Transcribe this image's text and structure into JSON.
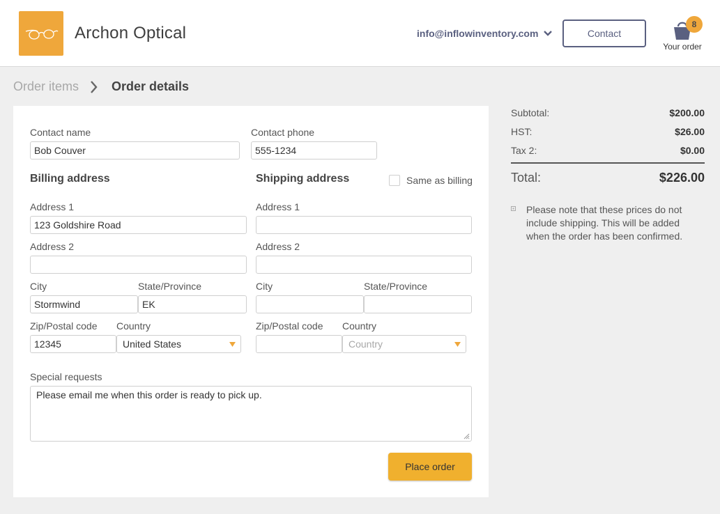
{
  "header": {
    "brand": "Archon Optical",
    "account_email": "info@inflowinventory.com",
    "contact_label": "Contact",
    "cart_count": "8",
    "cart_label": "Your order"
  },
  "breadcrumb": {
    "items": [
      "Order items",
      "Order details"
    ]
  },
  "form": {
    "contact_name_label": "Contact name",
    "contact_name_value": "Bob Couver",
    "contact_phone_label": "Contact phone",
    "contact_phone_value": "555-1234",
    "billing": {
      "title": "Billing address",
      "address1_label": "Address 1",
      "address1_value": "123 Goldshire Road",
      "address2_label": "Address 2",
      "address2_value": "",
      "city_label": "City",
      "city_value": "Stormwind",
      "state_label": "State/Province",
      "state_value": "EK",
      "zip_label": "Zip/Postal code",
      "zip_value": "12345",
      "country_label": "Country",
      "country_value": "United States"
    },
    "shipping": {
      "title": "Shipping address",
      "same_as_billing_label": "Same as billing",
      "same_as_billing_checked": false,
      "address1_label": "Address 1",
      "address1_value": "",
      "address2_label": "Address 2",
      "address2_value": "",
      "city_label": "City",
      "city_value": "",
      "state_label": "State/Province",
      "state_value": "",
      "zip_label": "Zip/Postal code",
      "zip_value": "",
      "country_label": "Country",
      "country_placeholder": "Country"
    },
    "special_requests_label": "Special requests",
    "special_requests_value": "Please email me when this order is ready to pick up.",
    "place_order_label": "Place order"
  },
  "summary": {
    "subtotal_label": "Subtotal:",
    "subtotal_value": "$200.00",
    "hst_label": "HST:",
    "hst_value": "$26.00",
    "tax2_label": "Tax 2:",
    "tax2_value": "$0.00",
    "total_label": "Total:",
    "total_value": "$226.00",
    "note": "Please note that these prices do not include shipping. This will be added when the order has been confirmed."
  },
  "icons": {
    "logo": "glasses-icon",
    "account_dropdown": "chevron-down-icon",
    "cart": "shopping-bag-icon",
    "breadcrumb_separator": "chevron-right-icon",
    "select_caret": "caret-down-icon",
    "note": "info-icon"
  },
  "colors": {
    "accent": "#efa73b",
    "button": "#f0b02e",
    "nav": "#5a6080",
    "background": "#efefef"
  }
}
